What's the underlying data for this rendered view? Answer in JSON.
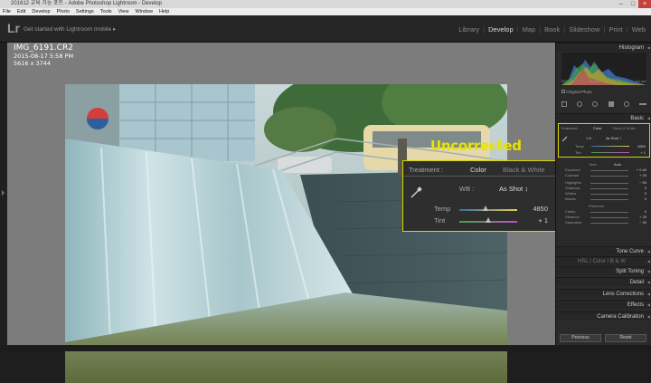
{
  "titlebar": {
    "title": "201612 교육 가능 포트 - Adobe Photoshop Lightroom - Develop"
  },
  "menubar": {
    "items": [
      "File",
      "Edit",
      "Develop",
      "Photo",
      "Settings",
      "Tools",
      "View",
      "Window",
      "Help"
    ]
  },
  "identity": {
    "logo": "Lr",
    "plate": "Get started with Lightroom mobile",
    "plate_arrow": "▸"
  },
  "modules": [
    "Library",
    "Develop",
    "Map",
    "Book",
    "Slideshow",
    "Print",
    "Web"
  ],
  "active_module": "Develop",
  "photo_info": {
    "filename": "IMG_6191.CR2",
    "date": "2015-08-17",
    "time": "5:58 PM",
    "dims": "5616 x 3744"
  },
  "annotation": {
    "label": "Uncorrected"
  },
  "zoom_panel": {
    "treatment_label": "Treatment :",
    "color_label": "Color",
    "bw_label": "Black & White",
    "wb_label": "WB :",
    "wb_value": "As Shot ↕",
    "temp_label": "Temp",
    "temp_value": "4850",
    "temp_fraction": 0.45,
    "tint_label": "Tint",
    "tint_value": "+ 1",
    "tint_fraction": 0.5
  },
  "right_panel": {
    "histogram_title": "Histogram",
    "histogram_info": [
      "ISO 125",
      "28 mm",
      "f / 11",
      "3.2 sec"
    ],
    "original_photo": "Original Photo",
    "basic_title": "Basic",
    "treatment": "Treatment :",
    "color": "Color",
    "bw": "Black & White",
    "wb": "WB :",
    "wb_value": "As Shot ↕",
    "temp": "Temp",
    "temp_value": "4850",
    "tint": "Tint",
    "tint_value": "+ 1",
    "tone": "Tone",
    "auto": "Auto",
    "exposure": "Exposure",
    "exposure_value": "+ 0.40",
    "contrast": "Contrast",
    "contrast_value": "+ 25",
    "highlights": "Highlights",
    "highlights_value": "− 50",
    "shadows": "Shadows",
    "shadows_value": "0",
    "whites": "Whites",
    "whites_value": "0",
    "blacks": "Blacks",
    "blacks_value": "0",
    "presence": "Presence",
    "clarity": "Clarity",
    "clarity_value": "0",
    "vibrance": "Vibrance",
    "vibrance_value": "+ 25",
    "saturation": "Saturation",
    "saturation_value": "− 30",
    "tone_curve": "Tone Curve",
    "hsl": "HSL",
    "hsl_color": "Color",
    "hsl_bw": "B & W",
    "split_toning": "Split Toning",
    "detail": "Detail",
    "lens_corrections": "Lens Corrections",
    "effects": "Effects",
    "camera_calibration": "Camera Calibration",
    "previous": "Previous",
    "reset": "Reset"
  },
  "colors": {
    "highlight": "#d9d400",
    "annotation_text": "#e8e300"
  }
}
